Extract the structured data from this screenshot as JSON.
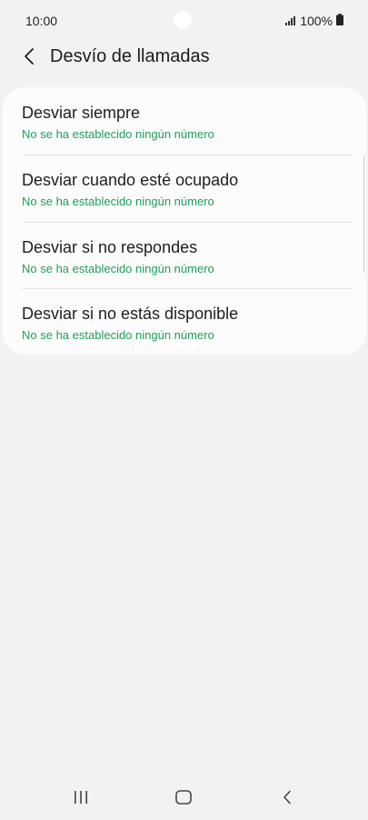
{
  "status_bar": {
    "time": "10:00",
    "battery_text": "100%",
    "icons": [
      "camera-cutout",
      "signal-icon",
      "battery-icon"
    ]
  },
  "header": {
    "title": "Desvío de llamadas",
    "back_icon": "back-chevron-icon"
  },
  "forwarding_options": [
    {
      "title": "Desviar siempre",
      "subtitle": "No se ha establecido ningún número"
    },
    {
      "title": "Desviar cuando esté ocupado",
      "subtitle": "No se ha establecido ningún número"
    },
    {
      "title": "Desviar si no respondes",
      "subtitle": "No se ha establecido ningún número"
    },
    {
      "title": "Desviar si no estás disponible",
      "subtitle": "No se ha establecido ningún número"
    }
  ],
  "nav_bar": {
    "icons": [
      "recent-apps-icon",
      "home-icon",
      "back-icon"
    ]
  },
  "colors": {
    "background": "#f2f2f2",
    "card": "#fcfcfc",
    "subtitle_accent": "#1e9e5a"
  }
}
